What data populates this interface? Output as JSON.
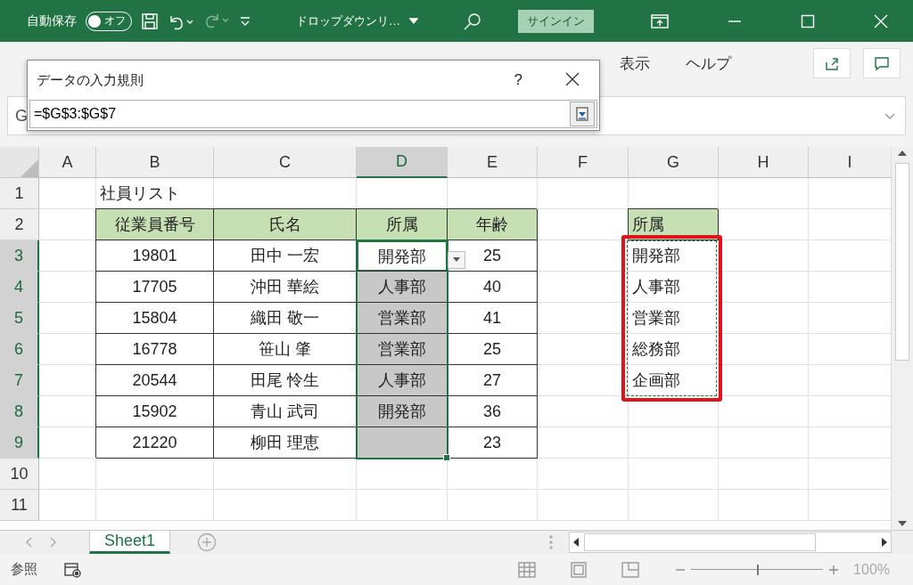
{
  "title_bar": {
    "autosave_label": "自動保存",
    "autosave_toggle": {
      "label": "オフ",
      "on": false
    },
    "redo_disabled": true,
    "document_title": "ドロップダウンリ…",
    "sign_in": "サインイン"
  },
  "ribbon": {
    "tabs": [
      {
        "label": "表示",
        "selected": false
      },
      {
        "label": "ヘルプ",
        "selected": false
      }
    ]
  },
  "formula_bar": {
    "name_box": "G"
  },
  "dialog": {
    "title": "データの入力規則",
    "help": "?",
    "value": "=$G$3:$G$7"
  },
  "sheet": {
    "copy_marquee": true,
    "red_frame": true,
    "columns": [
      {
        "label": "A",
        "selected": false
      },
      {
        "label": "B",
        "selected": false
      },
      {
        "label": "C",
        "selected": false
      },
      {
        "label": "D",
        "selected": true
      },
      {
        "label": "E",
        "selected": false
      },
      {
        "label": "F",
        "selected": false
      },
      {
        "label": "G",
        "selected": false
      },
      {
        "label": "H",
        "selected": false
      },
      {
        "label": "I",
        "selected": false
      }
    ],
    "rows": [
      {
        "number": "1",
        "selected": false,
        "cells": [
          {
            "selected": false
          },
          {
            "kind": "title",
            "text": "社員リスト",
            "selected": false
          },
          {
            "selected": false
          },
          {
            "selected": false
          },
          {
            "selected": false
          },
          {
            "selected": false
          },
          {
            "selected": false
          },
          {
            "selected": false
          },
          {
            "selected": false
          }
        ]
      },
      {
        "number": "2",
        "selected": false,
        "cells": [
          {
            "selected": false
          },
          {
            "kind": "header",
            "text": "従業員番号",
            "selected": false
          },
          {
            "kind": "header",
            "text": "氏名",
            "selected": false
          },
          {
            "kind": "header",
            "text": "所属",
            "selected": false
          },
          {
            "kind": "header",
            "text": "年齢",
            "selected": false
          },
          {
            "selected": false
          },
          {
            "kind": "list_header",
            "text": "所属",
            "selected": false
          },
          {
            "selected": false
          },
          {
            "selected": false
          }
        ]
      },
      {
        "number": "3",
        "selected": true,
        "cells": [
          {
            "selected": false
          },
          {
            "kind": "data",
            "text": "19801",
            "selected": false
          },
          {
            "kind": "data",
            "text": "田中 一宏",
            "selected": false
          },
          {
            "kind": "data",
            "text": "開発部",
            "selected": true,
            "active": true,
            "dropdown": true
          },
          {
            "kind": "data",
            "text": "25",
            "selected": false
          },
          {
            "selected": false
          },
          {
            "kind": "list",
            "text": "開発部",
            "selected": false
          },
          {
            "selected": false
          },
          {
            "selected": false
          }
        ]
      },
      {
        "number": "4",
        "selected": true,
        "cells": [
          {
            "selected": false
          },
          {
            "kind": "data",
            "text": "17705",
            "selected": false
          },
          {
            "kind": "data",
            "text": "沖田 華絵",
            "selected": false
          },
          {
            "kind": "data",
            "text": "人事部",
            "selected": true,
            "active": false
          },
          {
            "kind": "data",
            "text": "40",
            "selected": false
          },
          {
            "selected": false
          },
          {
            "kind": "list",
            "text": "人事部",
            "selected": false
          },
          {
            "selected": false
          },
          {
            "selected": false
          }
        ]
      },
      {
        "number": "5",
        "selected": true,
        "cells": [
          {
            "selected": false
          },
          {
            "kind": "data",
            "text": "15804",
            "selected": false
          },
          {
            "kind": "data",
            "text": "織田 敬一",
            "selected": false
          },
          {
            "kind": "data",
            "text": "営業部",
            "selected": true,
            "active": false
          },
          {
            "kind": "data",
            "text": "41",
            "selected": false
          },
          {
            "selected": false
          },
          {
            "kind": "list",
            "text": "営業部",
            "selected": false
          },
          {
            "selected": false
          },
          {
            "selected": false
          }
        ]
      },
      {
        "number": "6",
        "selected": true,
        "cells": [
          {
            "selected": false
          },
          {
            "kind": "data",
            "text": "16778",
            "selected": false
          },
          {
            "kind": "data",
            "text": "笹山 肇",
            "selected": false
          },
          {
            "kind": "data",
            "text": "営業部",
            "selected": true,
            "active": false
          },
          {
            "kind": "data",
            "text": "25",
            "selected": false
          },
          {
            "selected": false
          },
          {
            "kind": "list",
            "text": "総務部",
            "selected": false
          },
          {
            "selected": false
          },
          {
            "selected": false
          }
        ]
      },
      {
        "number": "7",
        "selected": true,
        "cells": [
          {
            "selected": false
          },
          {
            "kind": "data",
            "text": "20544",
            "selected": false
          },
          {
            "kind": "data",
            "text": "田尾 怜生",
            "selected": false
          },
          {
            "kind": "data",
            "text": "人事部",
            "selected": true,
            "active": false
          },
          {
            "kind": "data",
            "text": "27",
            "selected": false
          },
          {
            "selected": false
          },
          {
            "kind": "list",
            "text": "企画部",
            "selected": false
          },
          {
            "selected": false
          },
          {
            "selected": false
          }
        ]
      },
      {
        "number": "8",
        "selected": true,
        "cells": [
          {
            "selected": false
          },
          {
            "kind": "data",
            "text": "15902",
            "selected": false
          },
          {
            "kind": "data",
            "text": "青山 武司",
            "selected": false
          },
          {
            "kind": "data",
            "text": "開発部",
            "selected": true,
            "active": false
          },
          {
            "kind": "data",
            "text": "36",
            "selected": false
          },
          {
            "selected": false
          },
          {
            "selected": false
          },
          {
            "selected": false
          },
          {
            "selected": false
          }
        ]
      },
      {
        "number": "9",
        "selected": true,
        "cells": [
          {
            "selected": false
          },
          {
            "kind": "data",
            "text": "21220",
            "selected": false
          },
          {
            "kind": "data",
            "text": "柳田 理恵",
            "selected": false
          },
          {
            "kind": "data",
            "selected": true,
            "active": false
          },
          {
            "kind": "data",
            "text": "23",
            "selected": false
          },
          {
            "selected": false
          },
          {
            "selected": false
          },
          {
            "selected": false
          },
          {
            "selected": false
          }
        ]
      },
      {
        "number": "10",
        "selected": false,
        "cells": [
          {
            "selected": false
          },
          {
            "selected": false
          },
          {
            "selected": false
          },
          {
            "selected": false
          },
          {
            "selected": false
          },
          {
            "selected": false
          },
          {
            "selected": false
          },
          {
            "selected": false
          },
          {
            "selected": false
          }
        ]
      },
      {
        "number": "11",
        "selected": false,
        "cells": [
          {
            "selected": false
          },
          {
            "selected": false
          },
          {
            "selected": false
          },
          {
            "selected": false
          },
          {
            "selected": false
          },
          {
            "selected": false
          },
          {
            "selected": false
          },
          {
            "selected": false
          },
          {
            "selected": false
          }
        ]
      }
    ]
  },
  "sheet_tabs": [
    {
      "label": "Sheet1",
      "selected": true
    }
  ],
  "status_bar": {
    "mode": "参照",
    "zoom": {
      "level": 0.5
    },
    "zoom_text": "100%"
  }
}
